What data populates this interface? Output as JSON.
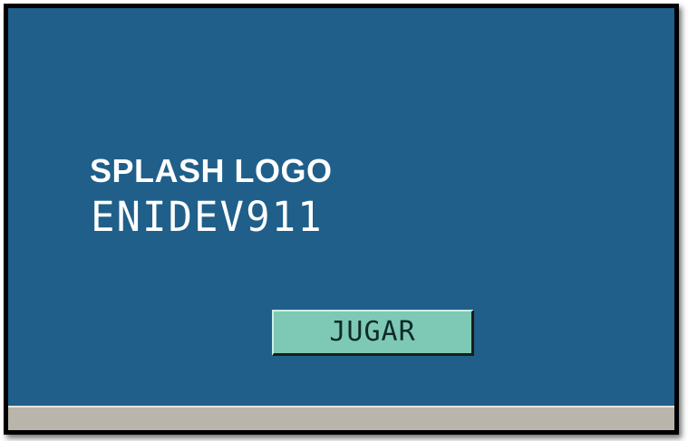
{
  "splash": {
    "title": "SPLASH LOGO",
    "subtitle": "ENIDEV911",
    "play_button_label": "JUGAR"
  },
  "colors": {
    "background": "#1f5f8a",
    "button": "#7ec9b6",
    "bottom_bar": "#bab5aa",
    "text": "#ffffff"
  }
}
